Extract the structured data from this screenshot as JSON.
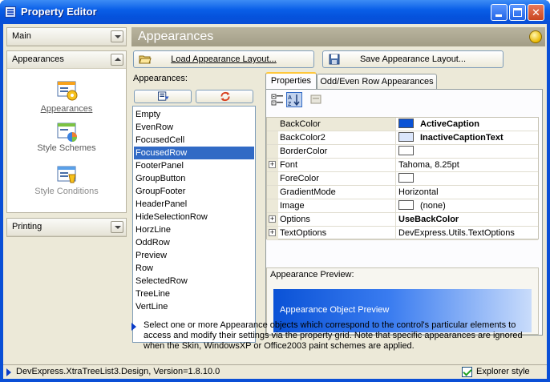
{
  "window": {
    "title": "Property Editor"
  },
  "nav": {
    "groups": [
      {
        "label": "Main"
      },
      {
        "label": "Appearances",
        "items": [
          {
            "label": "Appearances"
          },
          {
            "label": "Style Schemes"
          },
          {
            "label": "Style Conditions"
          }
        ]
      },
      {
        "label": "Printing"
      }
    ]
  },
  "panel": {
    "title": "Appearances",
    "load_label": "Load Appearance Layout...",
    "save_label": "Save Appearance Layout...",
    "list_header": "Appearances:",
    "list_items": [
      "Empty",
      "EvenRow",
      "FocusedCell",
      "FocusedRow",
      "FooterPanel",
      "GroupButton",
      "GroupFooter",
      "HeaderPanel",
      "HideSelectionRow",
      "HorzLine",
      "OddRow",
      "Preview",
      "Row",
      "SelectedRow",
      "TreeLine",
      "VertLine"
    ],
    "selected_item": "FocusedRow",
    "tabs": [
      {
        "label": "Properties"
      },
      {
        "label": "Odd/Even Row Appearances"
      }
    ],
    "grid": [
      {
        "name": "BackColor",
        "value": "ActiveCaption",
        "swatch": "#0a52d6",
        "bold": true
      },
      {
        "name": "BackColor2",
        "value": "InactiveCaptionText",
        "swatch": "#dbe6fb",
        "bold": true
      },
      {
        "name": "BorderColor",
        "value": "",
        "swatch": "#ffffff"
      },
      {
        "name": "Font",
        "value": "Tahoma, 8.25pt",
        "expand": true
      },
      {
        "name": "ForeColor",
        "value": "",
        "swatch": "#ffffff"
      },
      {
        "name": "GradientMode",
        "value": "Horizontal"
      },
      {
        "name": "Image",
        "value": "(none)",
        "swatch": "#ffffff"
      },
      {
        "name": "Options",
        "value": "UseBackColor",
        "expand": true,
        "bold": true
      },
      {
        "name": "TextOptions",
        "value": "DevExpress.Utils.TextOptions",
        "expand": true
      }
    ],
    "preview_header": "Appearance Preview:",
    "preview_text": "Appearance Object Preview",
    "description": "Select one or more Appearance objects which correspond to the control's particular elements to access and modify their settings via the property grid. Note that specific appearances are ignored when the Skin, WindowsXP or Office2003 paint schemes are applied."
  },
  "status": {
    "text": "DevExpress.XtraTreeList3.Design, Version=1.8.10.0",
    "explorer_style_label": "Explorer style"
  },
  "colors": {
    "accent": "#316ac5",
    "titlebar": "#0a5fe8"
  }
}
